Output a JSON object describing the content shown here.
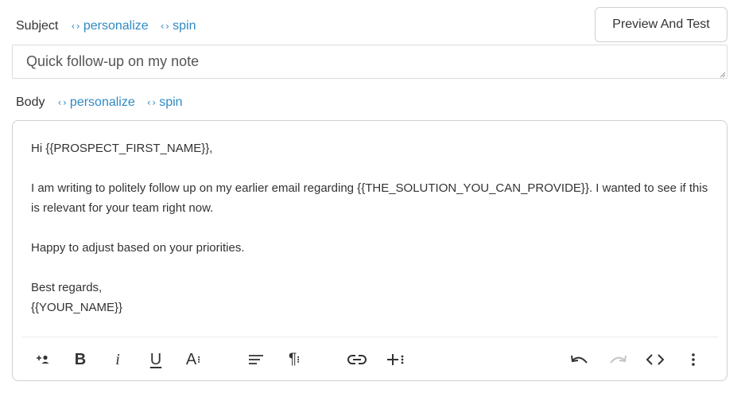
{
  "subject": {
    "label": "Subject",
    "personalize_label": "personalize",
    "spin_label": "spin",
    "value": "Quick follow-up on my note"
  },
  "preview_button": {
    "label": "Preview And Test"
  },
  "body": {
    "label": "Body",
    "personalize_label": "personalize",
    "spin_label": "spin",
    "paragraphs": [
      "Hi {{PROSPECT_FIRST_NAME}},",
      "I am writing to politely follow up on my earlier email regarding {{THE_SOLUTION_YOU_CAN_PROVIDE}}. I wanted to see if this is relevant for your team right now.",
      "Happy to adjust based on your priorities.",
      "Best regards,",
      "{{YOUR_NAME}}"
    ]
  },
  "toolbar": {
    "bold_glyph": "B",
    "italic_glyph": "i",
    "underline_glyph": "U",
    "font_glyph": "A",
    "icons": [
      "add-contact-icon",
      "bold-icon",
      "italic-icon",
      "underline-icon",
      "font-size-icon",
      "align-icon",
      "paragraph-icon",
      "link-icon",
      "insert-icon",
      "undo-icon",
      "redo-icon",
      "code-icon",
      "more-icon"
    ]
  },
  "colors": {
    "link": "#2f8ac4",
    "text": "#333333",
    "border": "#cfcfcf",
    "disabled_icon": "#c4c4c4"
  }
}
